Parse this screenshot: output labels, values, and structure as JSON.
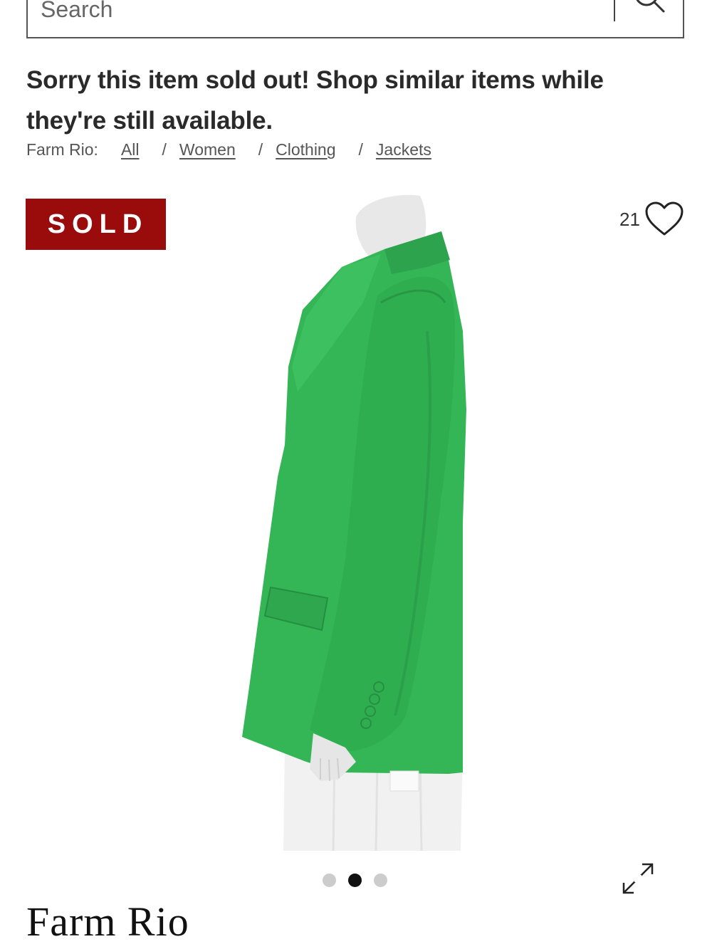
{
  "search": {
    "placeholder": "Search"
  },
  "notice": {
    "text": "Sorry this item sold out! Shop similar items while they're still available."
  },
  "breadcrumb": {
    "brand": "Farm Rio:",
    "items": [
      {
        "label": "All"
      },
      {
        "label": "Women"
      },
      {
        "label": "Clothing"
      },
      {
        "label": "Jackets"
      }
    ],
    "separator": "/"
  },
  "badge": {
    "label": "SOLD",
    "color": "#9a0b0b"
  },
  "favorites": {
    "count": "21",
    "icon": "heart-outline-icon"
  },
  "product": {
    "image_description_icon": "green-blazer-on-mannequin",
    "jacket_color": "#2fb552",
    "skirt_color": "#f2f2f2"
  },
  "carousel": {
    "total": 3,
    "active_index": 1
  },
  "brand_title": "Farm Rio"
}
